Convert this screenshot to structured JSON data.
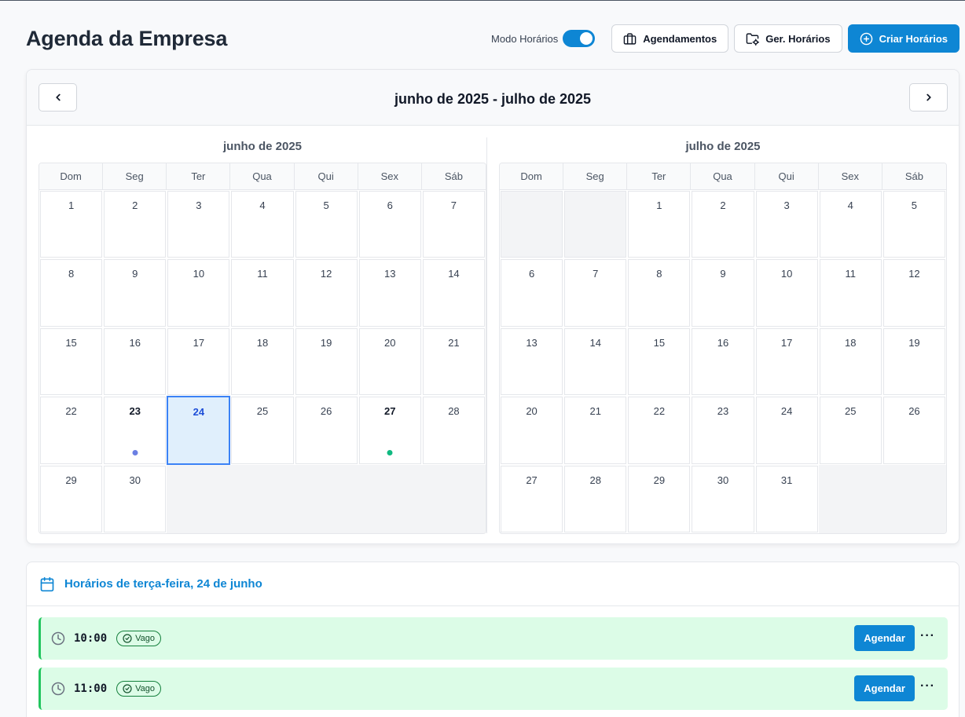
{
  "header": {
    "title": "Agenda da Empresa",
    "toggle_label": "Modo Horários",
    "toggle_on": true,
    "buttons": {
      "appointments": "Agendamentos",
      "manage_slots": "Ger. Horários",
      "create_slots": "Criar Horários"
    }
  },
  "calendar": {
    "range_title": "junho de 2025 - julho de 2025",
    "weekdays": [
      "Dom",
      "Seg",
      "Ter",
      "Qua",
      "Qui",
      "Sex",
      "Sáb"
    ],
    "months": [
      {
        "title": "junho de 2025",
        "leading_empty": 0,
        "days": 30,
        "bold_days": [
          23,
          24,
          27
        ],
        "selected_day": 24,
        "dots": [
          {
            "day": 23,
            "color": "#6b7fe3"
          },
          {
            "day": 27,
            "color": "#10b981"
          }
        ]
      },
      {
        "title": "julho de 2025",
        "leading_empty": 2,
        "days": 31,
        "bold_days": [],
        "selected_day": null,
        "dots": []
      }
    ]
  },
  "slots": {
    "title": "Horários de terça-feira, 24 de junho",
    "items": [
      {
        "time": "10:00",
        "status": "Vago",
        "action": "Agendar"
      },
      {
        "time": "11:00",
        "status": "Vago",
        "action": "Agendar"
      }
    ],
    "more_label": "···"
  },
  "colors": {
    "primary": "#0e86d4",
    "slot_bg": "#dcfce7",
    "slot_border": "#22c55e",
    "selected_bg": "#e0effc",
    "selected_border": "#3b82f6"
  }
}
